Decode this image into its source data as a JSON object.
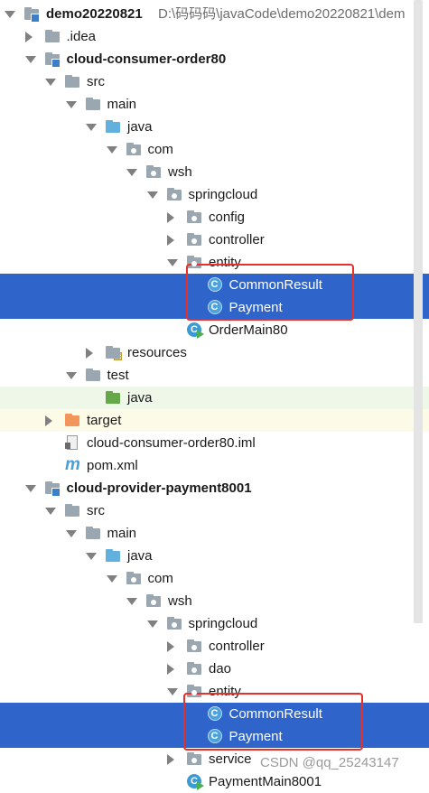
{
  "rows": [
    {
      "indent": 0,
      "expand": "down",
      "icon": "module",
      "label": "demo20220821",
      "bold": true,
      "path": "D:\\码码码\\javaCode\\demo20220821\\dem"
    },
    {
      "indent": 1,
      "expand": "right",
      "icon": "folder",
      "label": ".idea"
    },
    {
      "indent": 1,
      "expand": "down",
      "icon": "module",
      "label": "cloud-consumer-order80",
      "bold": true
    },
    {
      "indent": 2,
      "expand": "down",
      "icon": "folder",
      "label": "src"
    },
    {
      "indent": 3,
      "expand": "down",
      "icon": "folder",
      "label": "main"
    },
    {
      "indent": 4,
      "expand": "down",
      "icon": "folder-src",
      "label": "java"
    },
    {
      "indent": 5,
      "expand": "down",
      "icon": "package",
      "label": "com"
    },
    {
      "indent": 6,
      "expand": "down",
      "icon": "package",
      "label": "wsh"
    },
    {
      "indent": 7,
      "expand": "down",
      "icon": "package",
      "label": "springcloud"
    },
    {
      "indent": 8,
      "expand": "right",
      "icon": "package",
      "label": "config"
    },
    {
      "indent": 8,
      "expand": "right",
      "icon": "package",
      "label": "controller"
    },
    {
      "indent": 8,
      "expand": "down",
      "icon": "package",
      "label": "entity"
    },
    {
      "indent": 9,
      "expand": "none",
      "icon": "class",
      "label": "CommonResult",
      "selected": true
    },
    {
      "indent": 9,
      "expand": "none",
      "icon": "class",
      "label": "Payment",
      "selected": true
    },
    {
      "indent": 8,
      "expand": "none",
      "icon": "main-class",
      "label": "OrderMain80"
    },
    {
      "indent": 4,
      "expand": "right",
      "icon": "resources",
      "label": "resources"
    },
    {
      "indent": 3,
      "expand": "down",
      "icon": "folder",
      "label": "test"
    },
    {
      "indent": 4,
      "expand": "none",
      "icon": "folder-test",
      "label": "java",
      "style": "test-green"
    },
    {
      "indent": 2,
      "expand": "right",
      "icon": "folder-target",
      "label": "target",
      "style": "excluded"
    },
    {
      "indent": 2,
      "expand": "none",
      "icon": "iml",
      "label": "cloud-consumer-order80.iml"
    },
    {
      "indent": 2,
      "expand": "none",
      "icon": "maven",
      "label": "pom.xml"
    },
    {
      "indent": 1,
      "expand": "down",
      "icon": "module",
      "label": "cloud-provider-payment8001",
      "bold": true
    },
    {
      "indent": 2,
      "expand": "down",
      "icon": "folder",
      "label": "src"
    },
    {
      "indent": 3,
      "expand": "down",
      "icon": "folder",
      "label": "main"
    },
    {
      "indent": 4,
      "expand": "down",
      "icon": "folder-src",
      "label": "java"
    },
    {
      "indent": 5,
      "expand": "down",
      "icon": "package",
      "label": "com"
    },
    {
      "indent": 6,
      "expand": "down",
      "icon": "package",
      "label": "wsh"
    },
    {
      "indent": 7,
      "expand": "down",
      "icon": "package",
      "label": "springcloud"
    },
    {
      "indent": 8,
      "expand": "right",
      "icon": "package",
      "label": "controller"
    },
    {
      "indent": 8,
      "expand": "right",
      "icon": "package",
      "label": "dao"
    },
    {
      "indent": 8,
      "expand": "down",
      "icon": "package",
      "label": "entity"
    },
    {
      "indent": 9,
      "expand": "none",
      "icon": "class",
      "label": "CommonResult",
      "selected": true
    },
    {
      "indent": 9,
      "expand": "none",
      "icon": "class",
      "label": "Payment",
      "selected": true
    },
    {
      "indent": 8,
      "expand": "right",
      "icon": "package",
      "label": "service"
    },
    {
      "indent": 8,
      "expand": "none",
      "icon": "main-class",
      "label": "PaymentMain8001"
    }
  ],
  "class_badge": "C",
  "watermark": "CSDN @qq_25243147",
  "colors": {
    "selection": "#2f65ca",
    "highlight_box": "#e8302a",
    "source_folder": "#62b0de",
    "test_folder": "#65a84a",
    "excluded_folder": "#f1955b"
  }
}
